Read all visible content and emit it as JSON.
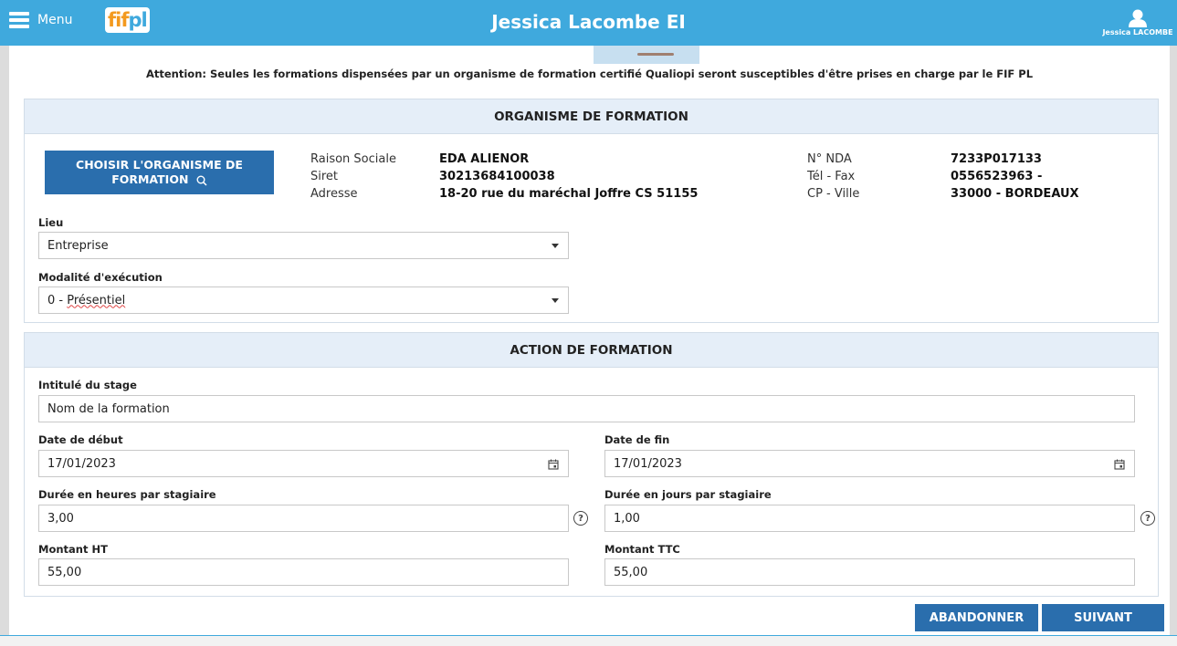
{
  "header": {
    "menu_label": "Menu",
    "logo_part1": "fif",
    "logo_part2": "pl",
    "title": "Jessica Lacombe EI",
    "user_name": "Jessica LACOMBE",
    "colors": {
      "bar": "#3fa9dd",
      "logo_orange": "#f39a1f"
    }
  },
  "notice": "Attention: Seules les formations dispensées par un organisme de formation certifié Qualiopi seront susceptibles d'être prises en charge par le FIF PL",
  "organisme": {
    "heading": "ORGANISME DE FORMATION",
    "choose_button": {
      "line1": "CHOISIR L'ORGANISME DE",
      "line2": "FORMATION",
      "icon": "search-icon"
    },
    "labels": {
      "raison": "Raison Sociale",
      "siret": "Siret",
      "adresse": "Adresse",
      "nda": "N° NDA",
      "tel": "Tél - Fax",
      "cp": "CP - Ville"
    },
    "values": {
      "raison": "EDA ALIENOR",
      "siret": "30213684100038",
      "adresse": "18-20 rue du maréchal Joffre CS 51155",
      "nda": "7233P017133",
      "tel": "0556523963 -",
      "cp": "33000 - BORDEAUX"
    },
    "lieu": {
      "label": "Lieu",
      "value": "Entreprise"
    },
    "modalite": {
      "label": "Modalité d'exécution",
      "value_prefix": "0 - ",
      "value_word": "Présentiel"
    }
  },
  "action": {
    "heading": "ACTION DE FORMATION",
    "intitule": {
      "label": "Intitulé du stage",
      "value": "Nom de la formation"
    },
    "date_debut": {
      "label": "Date de début",
      "value": "17/01/2023"
    },
    "date_fin": {
      "label": "Date de fin",
      "value": "17/01/2023"
    },
    "duree_heures": {
      "label": "Durée en heures par stagiaire",
      "value": "3,00"
    },
    "duree_jours": {
      "label": "Durée en jours par stagiaire",
      "value": "1,00"
    },
    "montant_ht": {
      "label": "Montant HT",
      "value": "55,00"
    },
    "montant_ttc": {
      "label": "Montant TTC",
      "value": "55,00"
    },
    "help_glyph": "?"
  },
  "buttons": {
    "abandon": "ABANDONNER",
    "next": "SUIVANT"
  }
}
